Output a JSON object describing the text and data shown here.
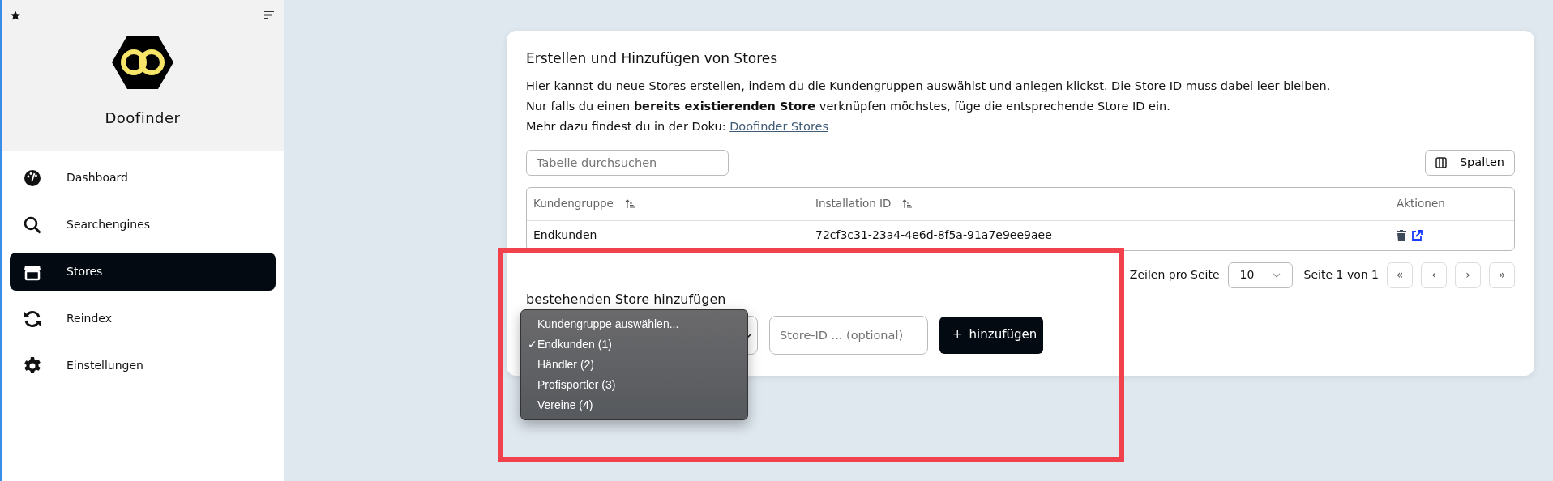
{
  "sidebar": {
    "brand": "Doofinder",
    "items": [
      {
        "label": "Dashboard",
        "selected": false
      },
      {
        "label": "Searchengines",
        "selected": false
      },
      {
        "label": "Stores",
        "selected": true
      },
      {
        "label": "Reindex",
        "selected": false
      },
      {
        "label": "Einstellungen",
        "selected": false
      }
    ]
  },
  "card": {
    "title": "Erstellen und Hinzufügen von Stores",
    "lines": [
      "Hier kannst du neue Stores erstellen, indem du die Kundengruppen auswählst und anlegen klickst. Die Store ID muss dabei leer bleiben.",
      "Nur falls du einen **bereits existierenden Store** verknüpfen möchstes, füge die entsprechende Store ID ein."
    ],
    "doc_text": "Mehr dazu findest du in der Doku:",
    "doc_link": "Doofinder Stores",
    "table": {
      "search_placeholder": "Tabelle durchsuchen",
      "columns_button": "Spalten",
      "columns": [
        {
          "label": "Kundengruppe",
          "sortable": true
        },
        {
          "label": "Installation ID",
          "sortable": true
        },
        {
          "label": "Aktionen",
          "sortable": false
        }
      ],
      "rows": [
        [
          "Endkunden",
          "72cf3c31-23a4-4e6d-8f5a-91a7e9ee9aee"
        ]
      ],
      "rows_per_page_label": "Zeilen pro Seite",
      "rows_per_page": "10",
      "page_info": "Seite 1 von 1",
      "pager": [
        "«",
        "‹",
        "›",
        "»"
      ]
    },
    "add_store": {
      "heading": "bestehenden Store hinzufügen",
      "options": [
        {
          "label": "Kundengruppe auswählen...",
          "selected": false
        },
        {
          "label": "Endkunden (1)",
          "selected": true
        },
        {
          "label": "Händler (2)",
          "selected": false
        },
        {
          "label": "Profisportler (3)",
          "selected": false
        },
        {
          "label": "Vereine (4)",
          "selected": false
        }
      ],
      "check_mark": "✓",
      "store_id_placeholder": "Store-ID ... (optional)",
      "button": "hinzufügen",
      "button_icon": "+"
    }
  }
}
